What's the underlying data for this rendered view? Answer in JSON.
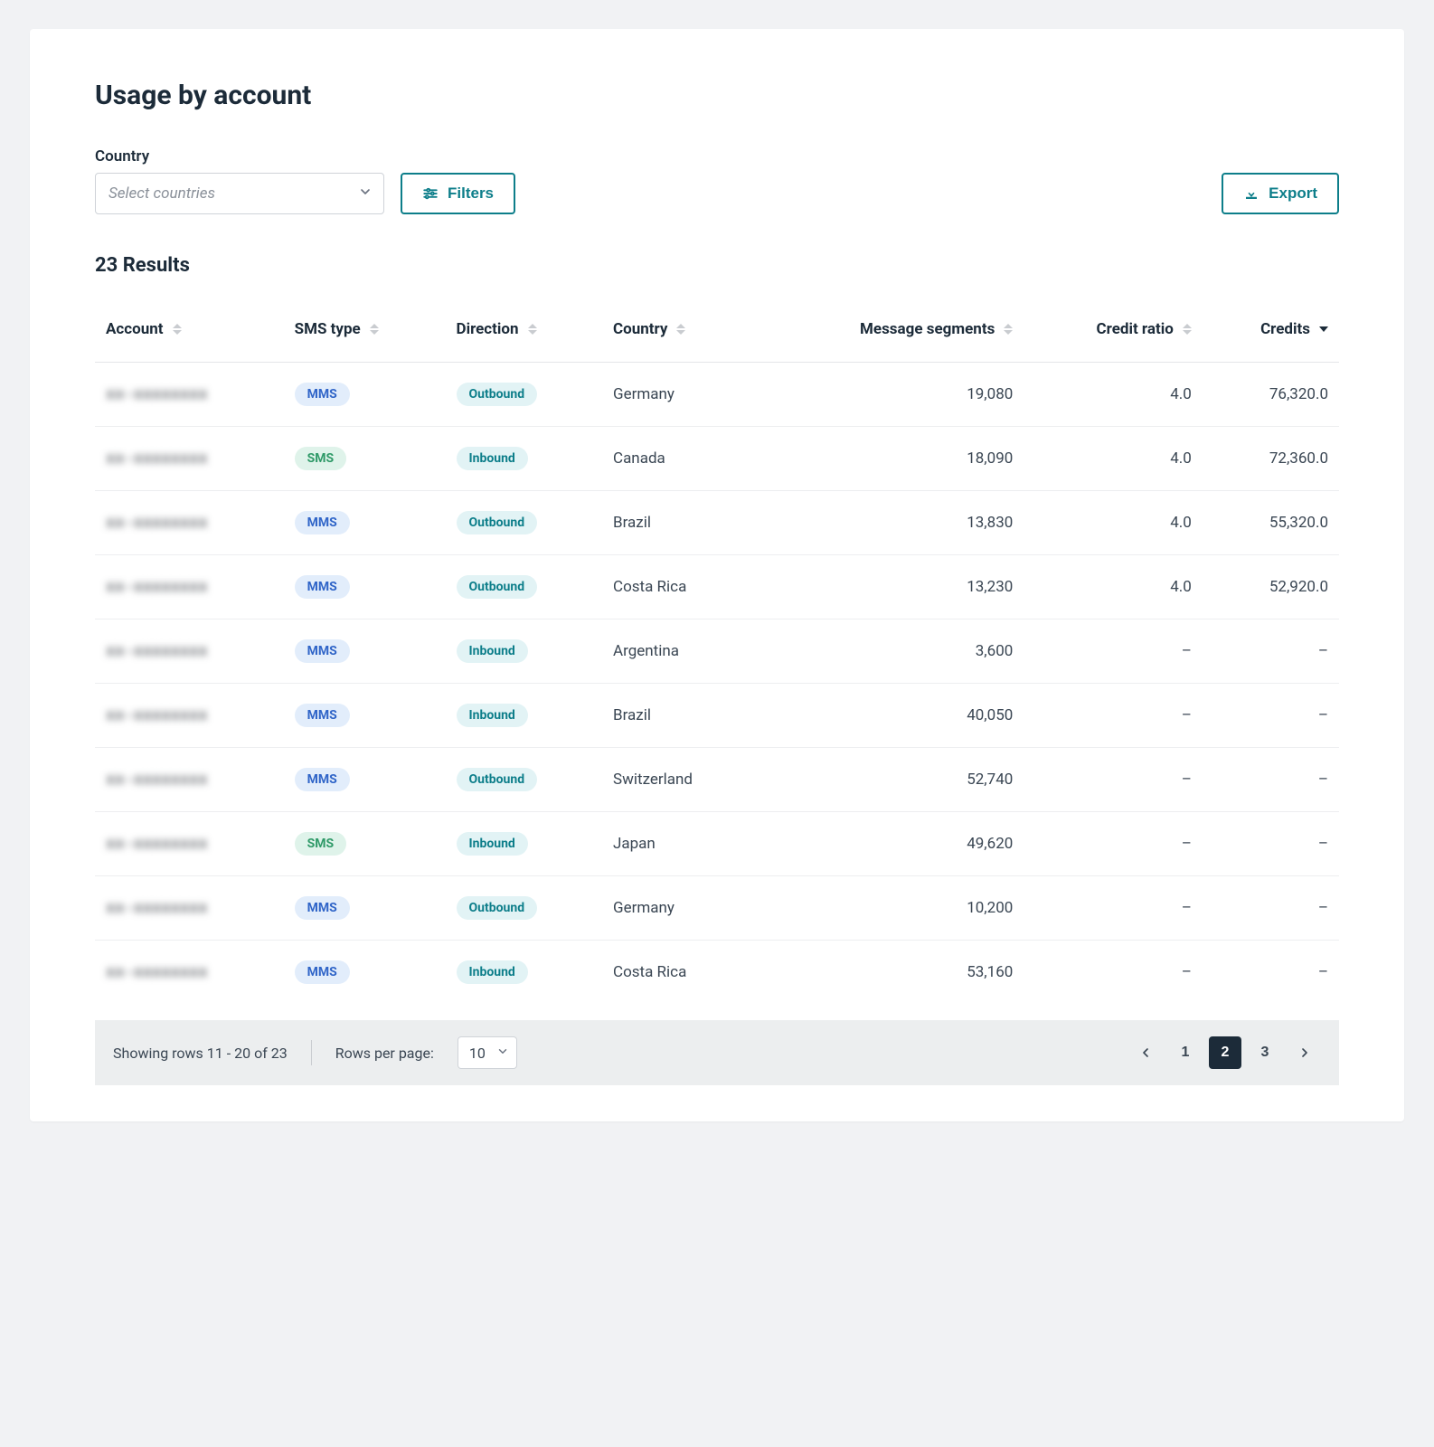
{
  "title": "Usage by account",
  "filters": {
    "country_label": "Country",
    "country_placeholder": "Select countries",
    "filters_button": "Filters",
    "export_button": "Export"
  },
  "results_label": "23 Results",
  "columns": [
    {
      "key": "account",
      "label": "Account",
      "align": "left",
      "sort": "both"
    },
    {
      "key": "sms_type",
      "label": "SMS type",
      "align": "left",
      "sort": "both"
    },
    {
      "key": "direction",
      "label": "Direction",
      "align": "left",
      "sort": "both"
    },
    {
      "key": "country",
      "label": "Country",
      "align": "left",
      "sort": "both"
    },
    {
      "key": "segments",
      "label": "Message segments",
      "align": "right",
      "sort": "both"
    },
    {
      "key": "ratio",
      "label": "Credit ratio",
      "align": "right",
      "sort": "both"
    },
    {
      "key": "credits",
      "label": "Credits",
      "align": "right",
      "sort": "desc"
    }
  ],
  "rows": [
    {
      "account": "xx-xxxxxxxx",
      "sms_type": "MMS",
      "direction": "Outbound",
      "country": "Germany",
      "segments": "19,080",
      "ratio": "4.0",
      "credits": "76,320.0"
    },
    {
      "account": "xx-xxxxxxxx",
      "sms_type": "SMS",
      "direction": "Inbound",
      "country": "Canada",
      "segments": "18,090",
      "ratio": "4.0",
      "credits": "72,360.0"
    },
    {
      "account": "xx-xxxxxxxx",
      "sms_type": "MMS",
      "direction": "Outbound",
      "country": "Brazil",
      "segments": "13,830",
      "ratio": "4.0",
      "credits": "55,320.0"
    },
    {
      "account": "xx-xxxxxxxx",
      "sms_type": "MMS",
      "direction": "Outbound",
      "country": "Costa Rica",
      "segments": "13,230",
      "ratio": "4.0",
      "credits": "52,920.0"
    },
    {
      "account": "xx-xxxxxxxx",
      "sms_type": "MMS",
      "direction": "Inbound",
      "country": "Argentina",
      "segments": "3,600",
      "ratio": "–",
      "credits": "–"
    },
    {
      "account": "xx-xxxxxxxx",
      "sms_type": "MMS",
      "direction": "Inbound",
      "country": "Brazil",
      "segments": "40,050",
      "ratio": "–",
      "credits": "–"
    },
    {
      "account": "xx-xxxxxxxx",
      "sms_type": "MMS",
      "direction": "Outbound",
      "country": "Switzerland",
      "segments": "52,740",
      "ratio": "–",
      "credits": "–"
    },
    {
      "account": "xx-xxxxxxxx",
      "sms_type": "SMS",
      "direction": "Inbound",
      "country": "Japan",
      "segments": "49,620",
      "ratio": "–",
      "credits": "–"
    },
    {
      "account": "xx-xxxxxxxx",
      "sms_type": "MMS",
      "direction": "Outbound",
      "country": "Germany",
      "segments": "10,200",
      "ratio": "–",
      "credits": "–"
    },
    {
      "account": "xx-xxxxxxxx",
      "sms_type": "MMS",
      "direction": "Inbound",
      "country": "Costa Rica",
      "segments": "53,160",
      "ratio": "–",
      "credits": "–"
    }
  ],
  "pagination": {
    "showing_text": "Showing rows 11 - 20 of 23",
    "rows_per_page_label": "Rows per page:",
    "rows_per_page_value": "10",
    "pages": [
      "1",
      "2",
      "3"
    ],
    "active_page": "2"
  }
}
